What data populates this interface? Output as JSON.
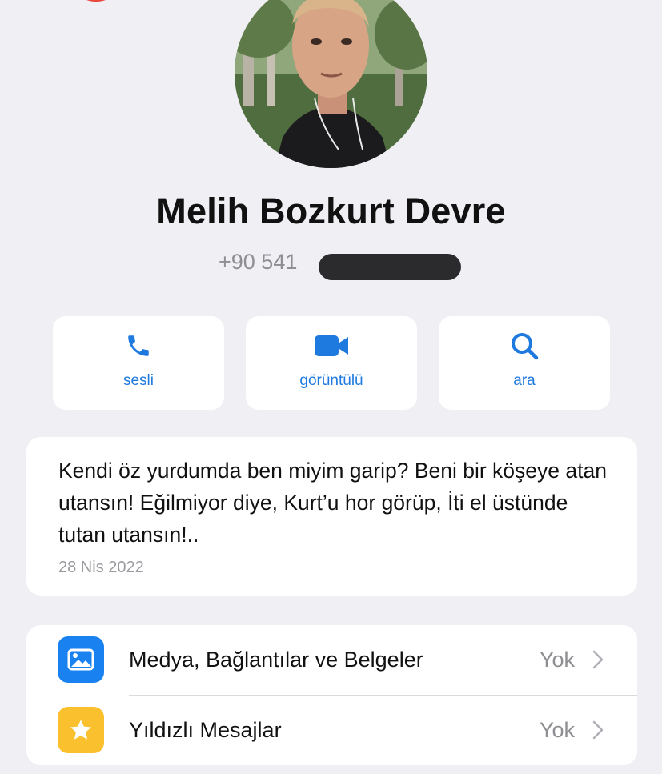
{
  "contact": {
    "name": "Melih Bozkurt Devre",
    "phone_visible": "+90 541"
  },
  "actions": [
    {
      "label": "sesli",
      "icon": "phone-icon"
    },
    {
      "label": "görüntülü",
      "icon": "video-camera-icon"
    },
    {
      "label": "ara",
      "icon": "search-icon"
    }
  ],
  "about": {
    "text": "Kendi öz yurdumda ben miyim garip?  Beni bir köşeye atan utansın! Eğilmiyor diye, Kurt’u hor görüp, İti el üstünde tutan utansın!..",
    "date": "28 Nis 2022"
  },
  "list": [
    {
      "label": "Medya, Bağlantılar ve Belgeler",
      "value": "Yok",
      "icon": "media-icon",
      "icon_color": "#1a82f0"
    },
    {
      "label": "Yıldızlı Mesajlar",
      "value": "Yok",
      "icon": "star-icon",
      "icon_color": "#fbc02d"
    }
  ],
  "colors": {
    "background": "#efeff4",
    "accent": "#1f7ae0",
    "secondary_text": "#8e8e93"
  }
}
